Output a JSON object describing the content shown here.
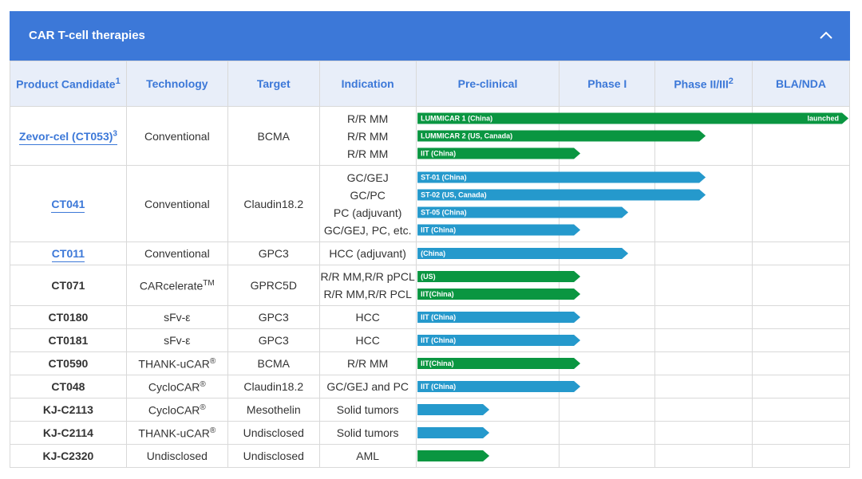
{
  "header": {
    "title": "CAR T-cell therapies",
    "collapse_icon": "chevron-up-icon"
  },
  "columns": [
    {
      "label": "Product Candidate",
      "sup": "1"
    },
    {
      "label": "Technology",
      "sup": ""
    },
    {
      "label": "Target",
      "sup": ""
    },
    {
      "label": "Indication",
      "sup": ""
    },
    {
      "label": "Pre-clinical",
      "sup": ""
    },
    {
      "label": "Phase I",
      "sup": ""
    },
    {
      "label": "Phase II/III",
      "sup": "2"
    },
    {
      "label": "BLA/NDA",
      "sup": ""
    }
  ],
  "colors": {
    "header_bg": "#3c78d8",
    "green": "#0a9641",
    "blue": "#2599cc"
  },
  "rows": [
    {
      "product": "Zevor-cel (CT053)",
      "product_sup": "3",
      "link": true,
      "technology": "Conventional",
      "tech_sup": "",
      "target": "BCMA",
      "indications": [
        {
          "text": "R/R MM",
          "bar": {
            "label": "LUMMICAR 1 (China)",
            "end_label": "launched",
            "color": "green",
            "stage_progress": 4.0
          }
        },
        {
          "text": "R/R MM",
          "bar": {
            "label": "LUMMICAR 2 (US, Canada)",
            "end_label": "",
            "color": "green",
            "stage_progress": 2.5
          }
        },
        {
          "text": "R/R MM",
          "bar": {
            "label": "IIT (China)",
            "end_label": "",
            "color": "green",
            "stage_progress": 1.2
          }
        }
      ]
    },
    {
      "product": "CT041",
      "product_sup": "",
      "link": true,
      "technology": "Conventional",
      "tech_sup": "",
      "target": "Claudin18.2",
      "indications": [
        {
          "text": "GC/GEJ",
          "bar": {
            "label": "ST-01 (China)",
            "end_label": "",
            "color": "blue",
            "stage_progress": 2.5
          }
        },
        {
          "text": "GC/PC",
          "bar": {
            "label": "ST-02 (US, Canada)",
            "end_label": "",
            "color": "blue",
            "stage_progress": 2.5
          }
        },
        {
          "text": "PC (adjuvant)",
          "bar": {
            "label": "ST-05 (China)",
            "end_label": "",
            "color": "blue",
            "stage_progress": 1.7
          }
        },
        {
          "text": "GC/GEJ, PC, etc.",
          "bar": {
            "label": "IIT (China)",
            "end_label": "",
            "color": "blue",
            "stage_progress": 1.2
          }
        }
      ]
    },
    {
      "product": "CT011",
      "product_sup": "",
      "link": true,
      "technology": "Conventional",
      "tech_sup": "",
      "target": "GPC3",
      "indications": [
        {
          "text": "HCC (adjuvant)",
          "bar": {
            "label": "(China)",
            "end_label": "",
            "color": "blue",
            "stage_progress": 1.7
          }
        }
      ]
    },
    {
      "product": "CT071",
      "product_sup": "",
      "link": false,
      "technology": "CARcelerate",
      "tech_sup": "TM",
      "target": "GPRC5D",
      "indications": [
        {
          "text": "R/R MM,R/R pPCL",
          "bar": {
            "label": "(US)",
            "end_label": "",
            "color": "green",
            "stage_progress": 1.2
          }
        },
        {
          "text": "R/R MM,R/R PCL",
          "bar": {
            "label": "IIT(China)",
            "end_label": "",
            "color": "green",
            "stage_progress": 1.2
          }
        }
      ]
    },
    {
      "product": "CT0180",
      "product_sup": "",
      "link": false,
      "technology": "sFv-ε",
      "tech_sup": "",
      "target": "GPC3",
      "indications": [
        {
          "text": "HCC",
          "bar": {
            "label": "IIT (China)",
            "end_label": "",
            "color": "blue",
            "stage_progress": 1.2
          }
        }
      ]
    },
    {
      "product": "CT0181",
      "product_sup": "",
      "link": false,
      "technology": "sFv-ε",
      "tech_sup": "",
      "target": "GPC3",
      "indications": [
        {
          "text": "HCC",
          "bar": {
            "label": "IIT (China)",
            "end_label": "",
            "color": "blue",
            "stage_progress": 1.2
          }
        }
      ]
    },
    {
      "product": "CT0590",
      "product_sup": "",
      "link": false,
      "technology": "THANK-uCAR",
      "tech_sup": "®",
      "target": "BCMA",
      "indications": [
        {
          "text": "R/R MM",
          "bar": {
            "label": "IIT(China)",
            "end_label": "",
            "color": "green",
            "stage_progress": 1.2
          }
        }
      ]
    },
    {
      "product": "CT048",
      "product_sup": "",
      "link": false,
      "technology": "CycloCAR",
      "tech_sup": "®",
      "target": "Claudin18.2",
      "indications": [
        {
          "text": "GC/GEJ and PC",
          "bar": {
            "label": "IIT (China)",
            "end_label": "",
            "color": "blue",
            "stage_progress": 1.2
          }
        }
      ]
    },
    {
      "product": "KJ-C2113",
      "product_sup": "",
      "link": false,
      "technology": "CycloCAR",
      "tech_sup": "®",
      "target": "Mesothelin",
      "indications": [
        {
          "text": "Solid tumors",
          "bar": {
            "label": "",
            "end_label": "",
            "color": "blue",
            "stage_progress": 0.5
          }
        }
      ]
    },
    {
      "product": "KJ-C2114",
      "product_sup": "",
      "link": false,
      "technology": "THANK-uCAR",
      "tech_sup": "®",
      "target": "Undisclosed",
      "indications": [
        {
          "text": "Solid tumors",
          "bar": {
            "label": "",
            "end_label": "",
            "color": "blue",
            "stage_progress": 0.5
          }
        }
      ]
    },
    {
      "product": "KJ-C2320",
      "product_sup": "",
      "link": false,
      "technology": "Undisclosed",
      "tech_sup": "",
      "target": "Undisclosed",
      "indications": [
        {
          "text": "AML",
          "bar": {
            "label": "",
            "end_label": "",
            "color": "green",
            "stage_progress": 0.5
          }
        }
      ]
    }
  ]
}
